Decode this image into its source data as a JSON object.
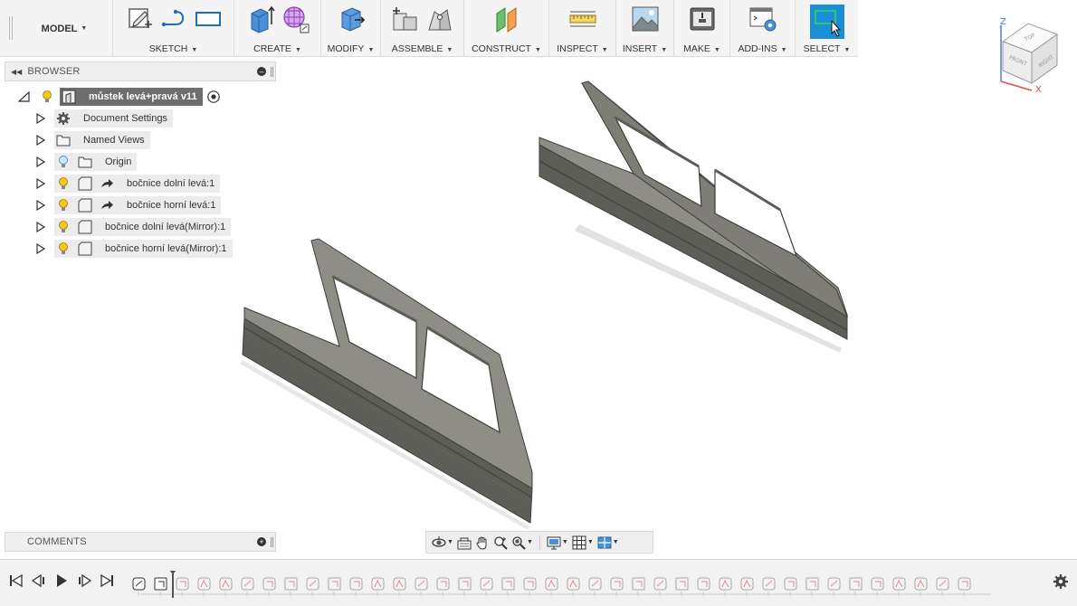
{
  "workspace": {
    "label": "MODEL"
  },
  "toolbar": {
    "groups": [
      {
        "label": "SKETCH"
      },
      {
        "label": "CREATE"
      },
      {
        "label": "MODIFY"
      },
      {
        "label": "ASSEMBLE"
      },
      {
        "label": "CONSTRUCT"
      },
      {
        "label": "INSPECT"
      },
      {
        "label": "INSERT"
      },
      {
        "label": "MAKE"
      },
      {
        "label": "ADD-INS"
      },
      {
        "label": "SELECT"
      }
    ],
    "accent_color": "#1a8fd6"
  },
  "browser": {
    "title": "BROWSER",
    "root": {
      "label": "můstek levá+pravá v11"
    },
    "items": [
      {
        "label": "Document Settings",
        "icon": "gear-icon"
      },
      {
        "label": "Named Views",
        "icon": "folder-icon"
      },
      {
        "label": "Origin",
        "icon": "folder-icon"
      },
      {
        "label": "bočnice dolní levá:1",
        "icon": "component-icon"
      },
      {
        "label": "bočnice horní levá:1",
        "icon": "component-icon"
      },
      {
        "label": "bočnice dolní levá(Mirror):1",
        "icon": "component-icon"
      },
      {
        "label": "bočnice horní levá(Mirror):1",
        "icon": "component-icon"
      }
    ]
  },
  "comments": {
    "title": "COMMENTS"
  },
  "viewcube": {
    "axis_z": "Z",
    "axis_x": "X",
    "faces": [
      "TOP",
      "FRONT",
      "RIGHT"
    ]
  },
  "colors": {
    "part_face": "#8a8a82",
    "part_side": "#5d5d57",
    "part_edge": "#3e3e3a",
    "light_on": "#f5c518"
  }
}
